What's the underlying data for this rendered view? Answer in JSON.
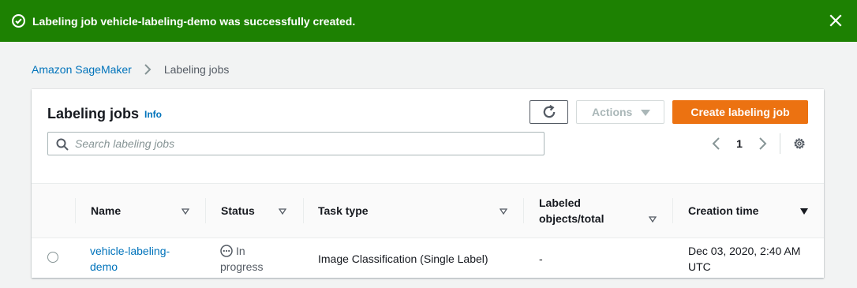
{
  "flash": {
    "icon": "success-check-icon",
    "message": "Labeling job vehicle-labeling-demo was successfully created.",
    "close_icon": "close-icon",
    "color": "#1d8102"
  },
  "breadcrumb": {
    "items": [
      "Amazon SageMaker",
      "Labeling jobs"
    ]
  },
  "panel": {
    "title": "Labeling jobs",
    "info_label": "Info",
    "refresh_icon": "refresh-icon",
    "actions_label": "Actions",
    "create_label": "Create labeling job",
    "accent_color": "#ec7211",
    "search": {
      "placeholder": "Search labeling jobs",
      "value": ""
    },
    "pagination": {
      "current_page": "1"
    },
    "settings_icon": "gear-icon"
  },
  "table": {
    "columns": [
      {
        "label": "Name",
        "sort_icon": "sort-down-outline-icon"
      },
      {
        "label": "Status",
        "sort_icon": "sort-down-outline-icon"
      },
      {
        "label": "Task type",
        "sort_icon": "sort-down-outline-icon"
      },
      {
        "label": "Labeled objects/total",
        "sort_icon": "sort-down-outline-icon"
      },
      {
        "label": "Creation time",
        "sort_icon": "sort-down-filled-icon"
      }
    ],
    "rows": [
      {
        "name": "vehicle-labeling-demo",
        "status": "In progress",
        "status_icon": "in-progress-icon",
        "task_type": "Image Classification (Single Label)",
        "labeled": "-",
        "creation_time": "Dec 03, 2020, 2:40 AM UTC"
      }
    ]
  }
}
